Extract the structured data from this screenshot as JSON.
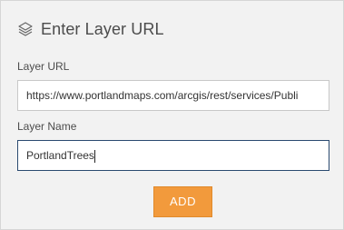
{
  "header": {
    "icon": "layers-icon",
    "title": "Enter Layer URL"
  },
  "form": {
    "url_label": "Layer URL",
    "url_value": "https://www.portlandmaps.com/arcgis/rest/services/Publi",
    "name_label": "Layer Name",
    "name_value": "PortlandTrees",
    "add_label": "ADD"
  },
  "colors": {
    "panel_bg": "#f2f2f2",
    "accent_button": "#f29a3c",
    "focused_border": "#2b4a70"
  }
}
